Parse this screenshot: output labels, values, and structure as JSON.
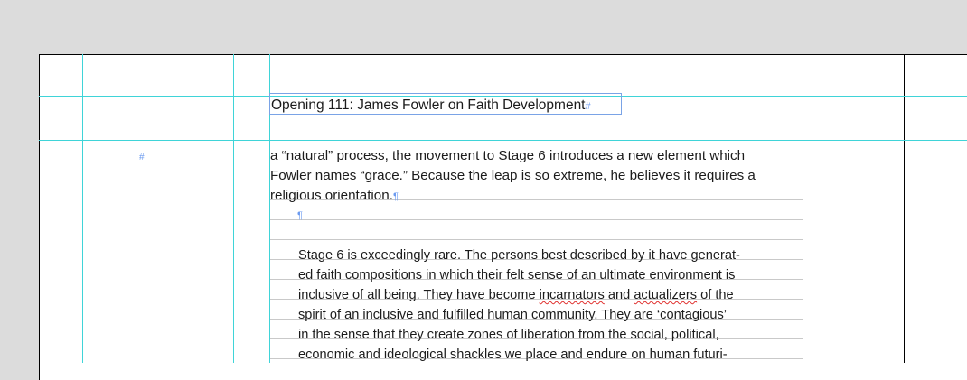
{
  "document": {
    "heading": "Opening 111: James Fowler on Faith Development",
    "heading_end_marker": "#",
    "anchor_marker": "#",
    "body_lines": [
      "a “natural” process, the movement to Stage 6 introduces a new element which",
      "Fowler names “grace.” Because the leap is so extreme, he believes it requires a",
      "religious orientation."
    ],
    "pilcrow": "¶",
    "quote_lines": [
      {
        "before": "Stage 6 is exceedingly rare. The persons best described by it have generat-",
        "flag": "",
        "after": ""
      },
      {
        "before": "ed faith compositions in which their felt sense of an ultimate environment is",
        "flag": "",
        "after": ""
      },
      {
        "before": "inclusive of all being. They have become ",
        "flag": "incarnators",
        "mid": " and ",
        "flag2": "actualizers",
        "after": " of the"
      },
      {
        "before": "spirit of an inclusive and fulfilled human community. They are ‘contagious’",
        "flag": "",
        "after": ""
      },
      {
        "before": "in the sense that they create zones of liberation from the social, political,",
        "flag": "",
        "after": ""
      },
      {
        "before": "economic and ideological shackles we place and endure on human futuri-",
        "flag": "",
        "after": ""
      }
    ]
  },
  "colors": {
    "guide": "#3fd4d8",
    "frame": "#7aa3e6",
    "pasteboard": "#dcdcdc",
    "spell_error": "#e0312f"
  }
}
